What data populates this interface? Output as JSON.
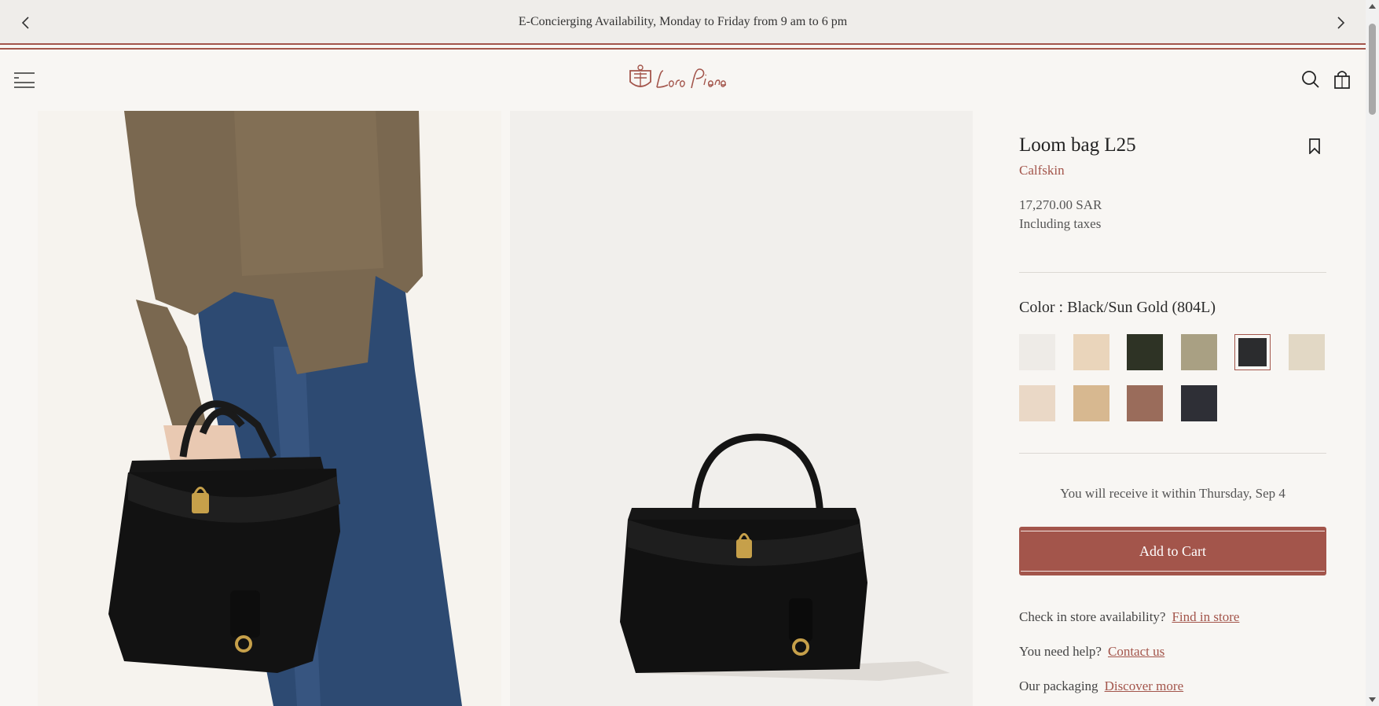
{
  "announcement": {
    "text": "E-Concierging Availability, Monday to Friday from 9 am to 6 pm",
    "prev_icon": "chevron-left-icon",
    "next_icon": "chevron-right-icon"
  },
  "header": {
    "menu_icon": "hamburger-menu-icon",
    "logo_text": "Loro Piana",
    "search_icon": "search-icon",
    "bag_icon": "shopping-bag-icon"
  },
  "product": {
    "title": "Loom bag L25",
    "material": "Calfskin",
    "price": "17,270.00 SAR",
    "tax_note": "Including taxes",
    "color_label": "Color : Black/Sun Gold (804L)",
    "swatches": [
      "#eeebe7",
      "#ead5bb",
      "#2e3325",
      "#a9a083",
      "#2b2c2e",
      "#e2d8c5",
      "#ead8c6",
      "#d7b890",
      "#9a6c5b",
      "#2e2f36"
    ],
    "selected_swatch_index": 4,
    "delivery": "You will receive it within Thursday, Sep 4",
    "add_to_cart": "Add to Cart",
    "store_question": "Check in store availability?",
    "store_link": "Find in store",
    "help_question": "You need help?",
    "help_link": "Contact us",
    "packaging_question": "Our packaging",
    "packaging_link": "Discover more"
  },
  "colors": {
    "accent": "#a3554b",
    "background": "#f8f6f3"
  }
}
